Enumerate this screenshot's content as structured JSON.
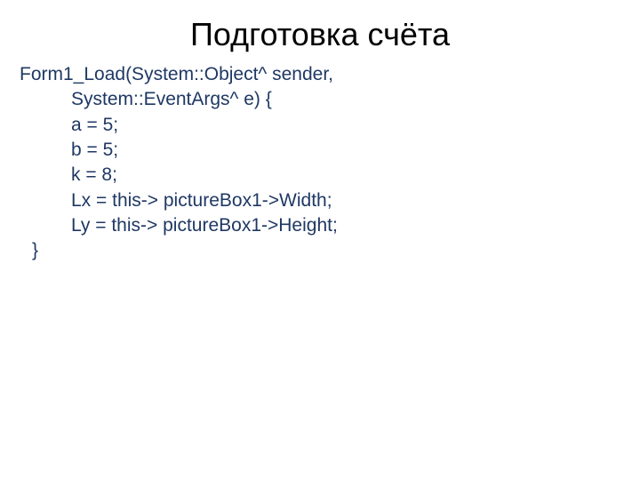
{
  "title": "Подготовка счёта",
  "code": {
    "l1": "Form1_Load(System::Object^  sender,",
    "l2": "System::EventArgs^  e) {",
    "l3": "a = 5;",
    "l4": "b = 5;",
    "l5": "k = 8;",
    "l6": "Lx = this-> pictureBox1->Width;",
    "l7": "Ly = this-> pictureBox1->Height;",
    "l8": "}"
  }
}
